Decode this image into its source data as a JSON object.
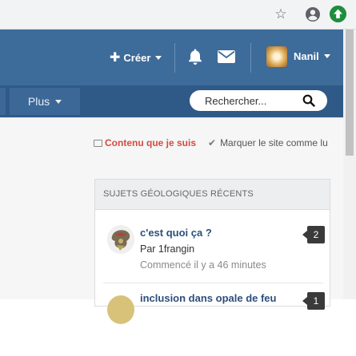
{
  "browser": {
    "star_icon": "star-icon",
    "account_icon": "account-circle-icon",
    "extension_icon": "green-arrow-up-icon",
    "extension_color": "#1e8e3e"
  },
  "header": {
    "create_label": "Créer",
    "user_name": "Nanil",
    "nav_more_label": "Plus",
    "search_placeholder": "Rechercher...",
    "colors": {
      "top": "#3d6b9a",
      "nav": "#2f5a88"
    }
  },
  "toolbar": {
    "my_content_label": "Contenu que je suis",
    "mark_read_label": "Marquer le site comme lu"
  },
  "widget": {
    "title": "SUJETS GÉOLOGIQUES RÉCENTS",
    "items": [
      {
        "title": "c'est quoi ça ?",
        "by": "Par 1frangin",
        "time": "Commencé il y a 46 minutes",
        "count": "2"
      },
      {
        "title": "inclusion dans opale de feu",
        "count": "1"
      }
    ]
  }
}
